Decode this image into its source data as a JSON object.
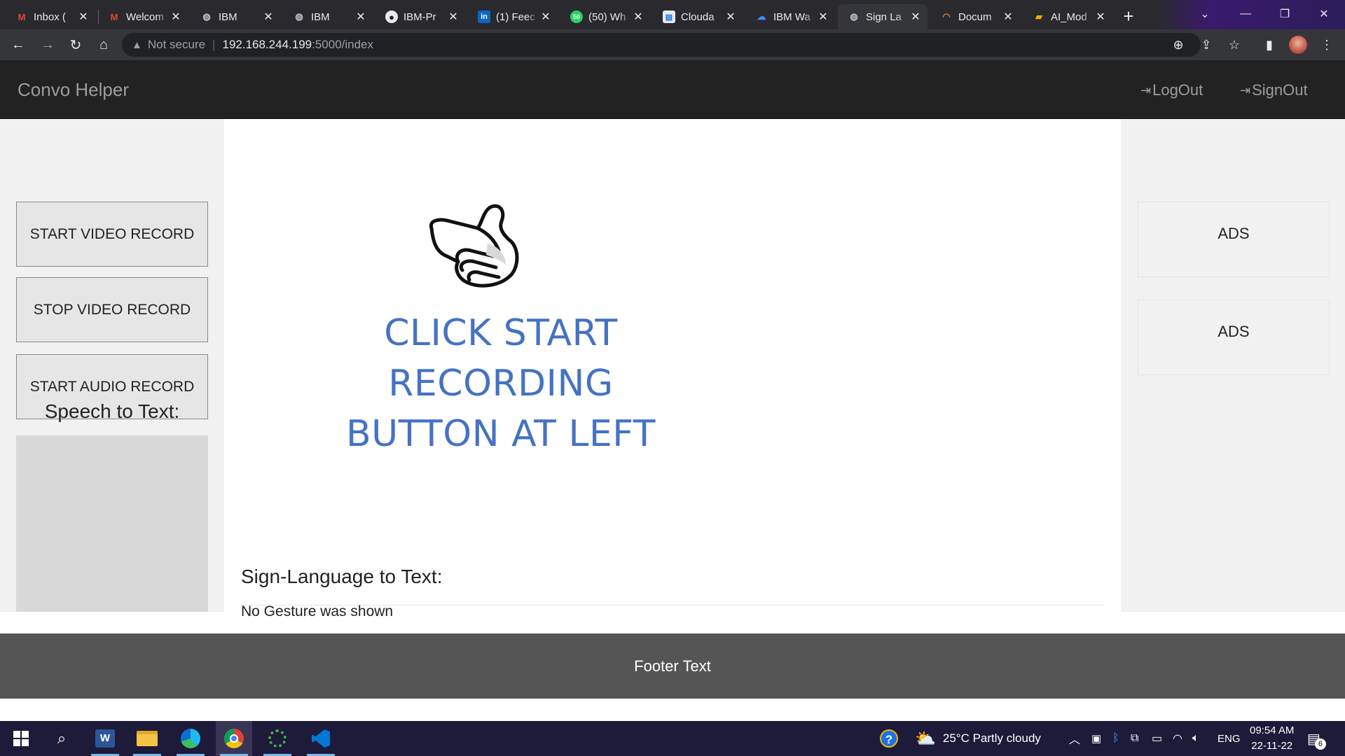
{
  "browser": {
    "tabs": [
      {
        "title": "Inbox (",
        "icon": "gmail-icon",
        "active": false
      },
      {
        "title": "Welcom",
        "icon": "gmail-icon",
        "active": false
      },
      {
        "title": "IBM",
        "icon": "globe-icon",
        "active": false
      },
      {
        "title": "IBM",
        "icon": "globe-icon",
        "active": false
      },
      {
        "title": "IBM-Pr",
        "icon": "github-icon",
        "active": false
      },
      {
        "title": "(1) Feec",
        "icon": "linkedin-icon",
        "active": false
      },
      {
        "title": "(50) Wh",
        "icon": "whatsapp-icon",
        "active": false
      },
      {
        "title": "Clouda",
        "icon": "document-icon",
        "active": false
      },
      {
        "title": "IBM Wa",
        "icon": "ibm-cloud-icon",
        "active": false
      },
      {
        "title": "Sign La",
        "icon": "globe-icon",
        "active": true
      },
      {
        "title": "Docum",
        "icon": "jupyter-icon",
        "active": false
      },
      {
        "title": "AI_Mod",
        "icon": "notebook-icon",
        "active": false
      }
    ],
    "address": {
      "security": "Not secure",
      "host": "192.168.244.199",
      "path": ":5000/index"
    }
  },
  "app": {
    "brand": "Convo Helper",
    "nav": {
      "logout": "LogOut",
      "signout": "SignOut"
    },
    "left": {
      "start_video": "START VIDEO RECORD",
      "stop_video": "STOP VIDEO RECORD",
      "start_audio": "START AUDIO RECORD",
      "speech_title": "Speech to Text:",
      "speech_text": ""
    },
    "main": {
      "prompt_line1": "CLICK START RECORDING",
      "prompt_line2": "BUTTON AT LEFT",
      "sign_title": "Sign-Language to Text:",
      "sign_result": "No Gesture was shown"
    },
    "ads": [
      "ADS",
      "ADS"
    ],
    "footer": "Footer Text"
  },
  "taskbar": {
    "weather": "25°C  Partly cloudy",
    "lang": "ENG",
    "time": "09:54 AM",
    "date": "22-11-22",
    "notifications": "6"
  },
  "colors": {
    "prompt": "#4472c4",
    "navbar": "#222222",
    "footer": "#555555"
  }
}
